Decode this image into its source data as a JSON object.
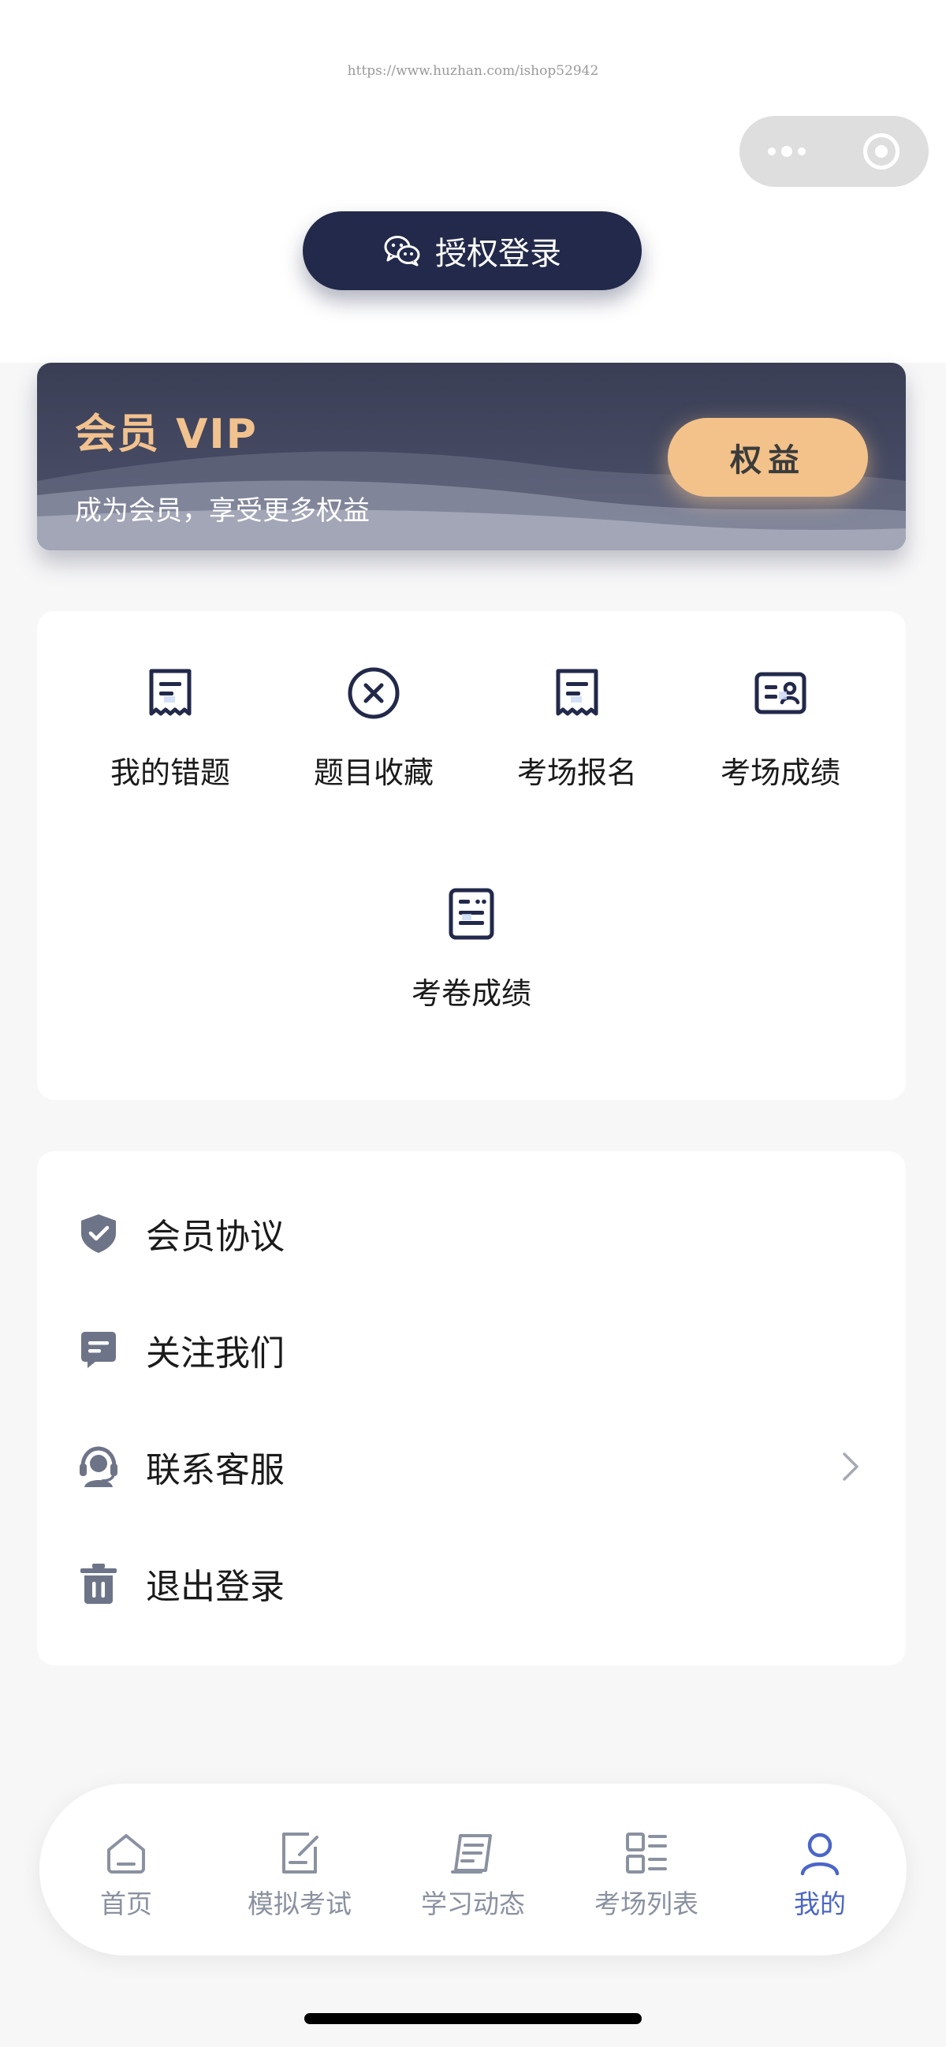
{
  "watermark": "https://www.huzhan.com/ishop52942",
  "header": {
    "login_button_label": "授权登录"
  },
  "vip_card": {
    "title": "会员 VIP",
    "subtitle": "成为会员，享受更多权益",
    "button_label": "权益"
  },
  "functions": {
    "items": [
      {
        "label": "我的错题",
        "icon": "receipt-doc-icon"
      },
      {
        "label": "题目收藏",
        "icon": "circle-x-icon"
      },
      {
        "label": "考场报名",
        "icon": "receipt-doc-icon"
      },
      {
        "label": "考场成绩",
        "icon": "id-card-icon"
      },
      {
        "label": "考卷成绩",
        "icon": "document-list-icon"
      }
    ]
  },
  "menu": {
    "items": [
      {
        "label": "会员协议",
        "icon": "shield-check-icon"
      },
      {
        "label": "关注我们",
        "icon": "chat-bubble-icon"
      },
      {
        "label": "联系客服",
        "icon": "headset-icon",
        "has_chevron": true
      },
      {
        "label": "退出登录",
        "icon": "trash-icon"
      }
    ]
  },
  "tabbar": {
    "active_index": 4,
    "items": [
      {
        "label": "首页",
        "icon": "home-icon"
      },
      {
        "label": "模拟考试",
        "icon": "edit-note-icon"
      },
      {
        "label": "学习动态",
        "icon": "notepad-icon"
      },
      {
        "label": "考场列表",
        "icon": "grid-list-icon"
      },
      {
        "label": "我的",
        "icon": "user-icon"
      }
    ]
  },
  "colors": {
    "primary_dark": "#22294a",
    "vip_gold": "#f2c28a",
    "active_tab": "#4b66c8",
    "inactive_tab": "#8a91a0",
    "menu_icon": "#6e7488"
  }
}
